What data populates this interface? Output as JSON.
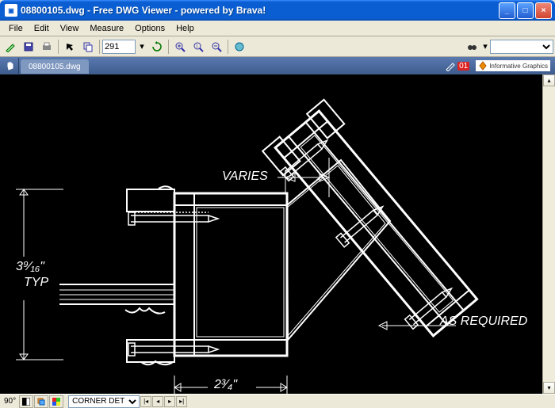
{
  "titlebar": {
    "title": "08800105.dwg - Free DWG Viewer - powered by Brava!",
    "icon_glyph": "▣"
  },
  "menu": {
    "items": [
      "File",
      "Edit",
      "View",
      "Measure",
      "Options",
      "Help"
    ]
  },
  "toolbar": {
    "page_value": "291",
    "search_placeholder": ""
  },
  "tabs": {
    "current": "08800105.dwg",
    "badge_red": "01",
    "ig_label": "Informative Graphics"
  },
  "drawing": {
    "labels": {
      "varies": "VARIES",
      "as_required": "AS REQUIRED",
      "dim_left": "3⁹⁄₁₆\"",
      "dim_left_typ": "TYP",
      "dim_bottom": "2³⁄₄\""
    }
  },
  "status": {
    "angle": "90°",
    "layout": "CORNER DET"
  }
}
